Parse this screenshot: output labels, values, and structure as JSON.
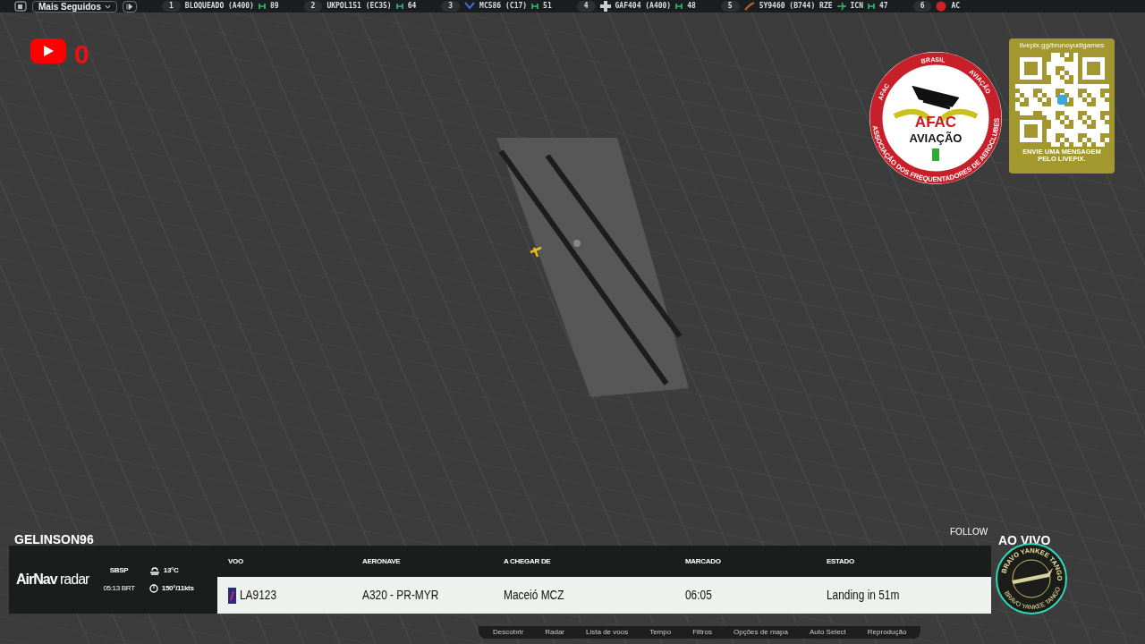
{
  "top_bar": {
    "dropdown": "Mais Seguidos",
    "tracked": [
      {
        "rank": "1",
        "kind": "plain",
        "callsign": "BLOQUEADO (A400)",
        "count": "89"
      },
      {
        "rank": "2",
        "kind": "plain",
        "callsign": "UKPOL151 (EC35)",
        "count": "64"
      },
      {
        "rank": "3",
        "kind": "chevron",
        "callsign": "MC586 (C17)",
        "count": "51"
      },
      {
        "rank": "4",
        "kind": "cross",
        "callsign": "GAF404 (A400)",
        "count": "48"
      },
      {
        "rank": "5",
        "kind": "swoosh",
        "callsign": "5Y9460 (B744) RZE",
        "destination": "ICN",
        "count": "47"
      },
      {
        "rank": "6",
        "kind": "roundel",
        "callsign": "AC"
      }
    ]
  },
  "youtube_counter": "0",
  "afac_badge": {
    "top": "BRASIL",
    "left": "AFAC",
    "right": "AVIAÇÃO",
    "bottom": "ASSOCIAÇÃO DOS FREQUENTADORES DE AEROCLUBES",
    "name": "AFAC",
    "subtitle": "AVIAÇÃO"
  },
  "livepix": {
    "url": "livepix.gg/brunoyudigames",
    "caption": "ENVIE UMA MENSAGEM PELO LIVEPIX."
  },
  "streamer": "GELINSON96",
  "follow_label": "FOLLOW",
  "live_label": "AO VIVO",
  "channel_badge": {
    "top": "BRAVO YANKEE TANGO",
    "bottom": "BRAVO YANKEE TANGO"
  },
  "airnav": {
    "logo_bold": "AirNav",
    "logo_light": "radar",
    "airport": "SBSP",
    "time": "05:13 BRT",
    "temperature": "13°C",
    "wind": "150°/11kts",
    "columns": [
      "VOO",
      "AERONAVE",
      "A CHEGAR DE",
      "MARCADO",
      "ESTADO"
    ],
    "row": [
      "LA9123",
      "A320 - PR-MYR",
      "Maceió MCZ",
      "06:05",
      "Landing in 51m"
    ]
  },
  "map_menu": [
    "Descobrir",
    "Radar",
    "Lista de voos",
    "Tempo",
    "Filtros",
    "Opções de mapa",
    "Auto Select",
    "Reprodução"
  ]
}
